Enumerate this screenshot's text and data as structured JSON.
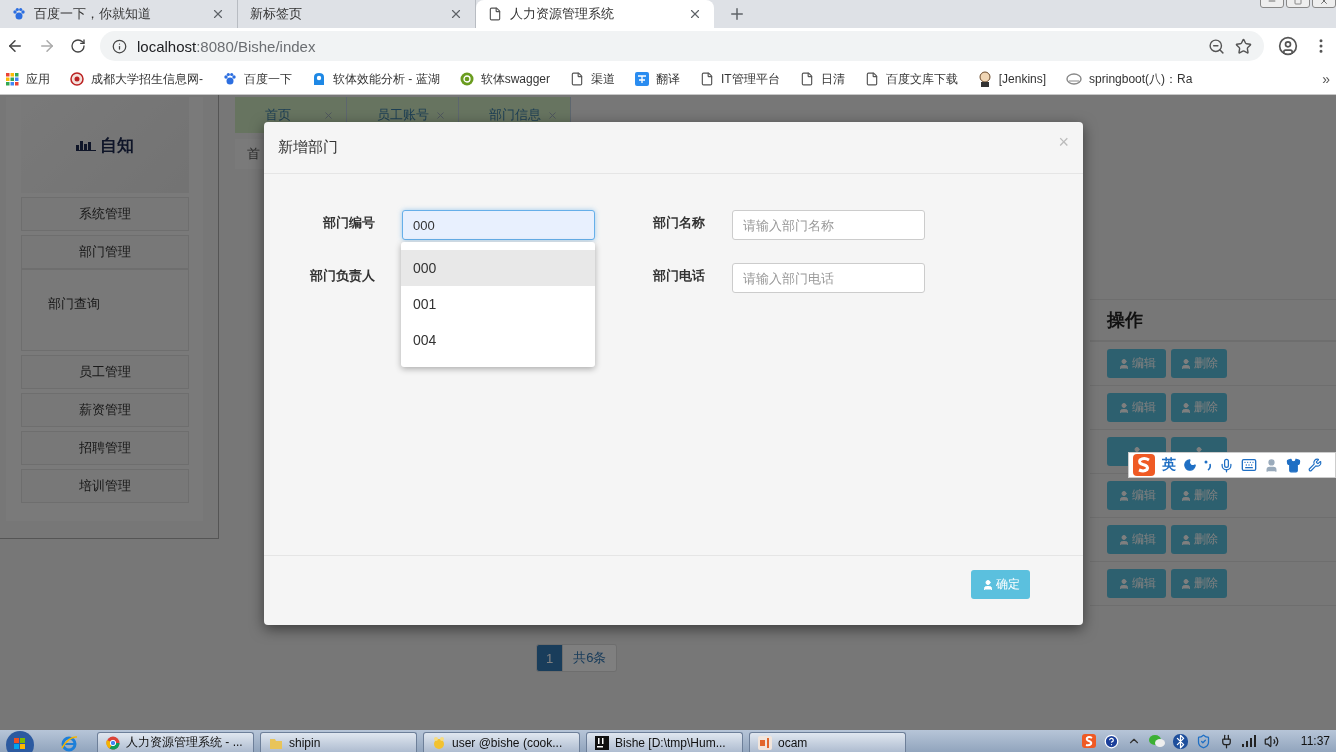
{
  "browser": {
    "tabs": [
      {
        "label": "百度一下，你就知道",
        "kind": "paw",
        "selected": false
      },
      {
        "label": "新标签页",
        "kind": "none",
        "selected": false
      },
      {
        "label": "人力资源管理系统",
        "kind": "page",
        "selected": true
      }
    ],
    "address": {
      "host": "localhost",
      "path": ":8080/Bishe/index"
    },
    "bookmarks": [
      {
        "label": "应用",
        "kind": "apps"
      },
      {
        "label": "成都大学招生信息网-",
        "kind": "seal"
      },
      {
        "label": "百度一下",
        "kind": "paw"
      },
      {
        "label": "软体效能分析 - 蓝湖",
        "kind": "lanhu"
      },
      {
        "label": "软体swagger",
        "kind": "swagger"
      },
      {
        "label": "渠道",
        "kind": "page"
      },
      {
        "label": "翻译",
        "kind": "translate"
      },
      {
        "label": "IT管理平台",
        "kind": "page"
      },
      {
        "label": "日清",
        "kind": "page"
      },
      {
        "label": "百度文库下载",
        "kind": "page"
      },
      {
        "label": "[Jenkins]",
        "kind": "jenkins"
      },
      {
        "label": "springboot(八)：Ra",
        "kind": "cloud"
      }
    ],
    "more": "»"
  },
  "sidebar": {
    "logo": "自知",
    "items": [
      {
        "label": "系统管理"
      },
      {
        "label": "部门管理",
        "children": [
          {
            "label": "部门查询"
          }
        ]
      },
      {
        "label": "员工管理"
      },
      {
        "label": "薪资管理"
      },
      {
        "label": "招聘管理"
      },
      {
        "label": "培训管理"
      }
    ]
  },
  "page_tabs": [
    {
      "label": "首页"
    },
    {
      "label": "员工账号"
    },
    {
      "label": "部门信息"
    }
  ],
  "breadcrumb": "首",
  "table": {
    "columns": [
      "操作"
    ],
    "rows": [
      {
        "actions": [
          {
            "kind": "edit",
            "label": "编辑"
          },
          {
            "kind": "delete",
            "label": "删除"
          }
        ]
      },
      {
        "actions": [
          {
            "kind": "edit",
            "label": "编辑"
          },
          {
            "kind": "delete",
            "label": "删除"
          }
        ]
      },
      {
        "actions": [
          {
            "kind": "edit"
          },
          {
            "kind": "delete"
          }
        ]
      },
      {
        "actions": [
          {
            "kind": "edit",
            "label": "编辑"
          },
          {
            "kind": "delete",
            "label": "删除"
          }
        ]
      },
      {
        "actions": [
          {
            "kind": "edit",
            "label": "编辑"
          },
          {
            "kind": "delete",
            "label": "删除"
          }
        ]
      },
      {
        "actions": [
          {
            "kind": "edit",
            "label": "编辑"
          },
          {
            "kind": "delete",
            "label": "删除"
          }
        ]
      }
    ]
  },
  "pagination": {
    "pages": [
      {
        "label": "1",
        "selected": true
      }
    ],
    "total": "共6条"
  },
  "modal": {
    "title": "新增部门",
    "close": "×",
    "fields": [
      {
        "label": "部门编号",
        "value": "000",
        "focused": true
      },
      {
        "label": "部门名称",
        "placeholder": "请输入部门名称"
      },
      {
        "label": "部门负责人"
      },
      {
        "label": "部门电话",
        "placeholder": "请输入部门电话"
      }
    ],
    "dropdown": {
      "options": [
        {
          "label": "000",
          "selected": true
        },
        {
          "label": "001",
          "selected": false
        },
        {
          "label": "004",
          "selected": false
        }
      ]
    },
    "confirm": "确定"
  },
  "ime": {
    "mode": "英"
  },
  "taskbar": {
    "tasks": [
      {
        "label": "人力资源管理系统 - ...",
        "kind": "chrome"
      },
      {
        "label": "shipin",
        "kind": "folder"
      },
      {
        "label": "user @bishe (cook...",
        "kind": "db"
      },
      {
        "label": "Bishe [D:\\tmp\\Hum...",
        "kind": "ij"
      },
      {
        "label": "ocam",
        "kind": "ocam"
      }
    ],
    "time": "11:37"
  }
}
